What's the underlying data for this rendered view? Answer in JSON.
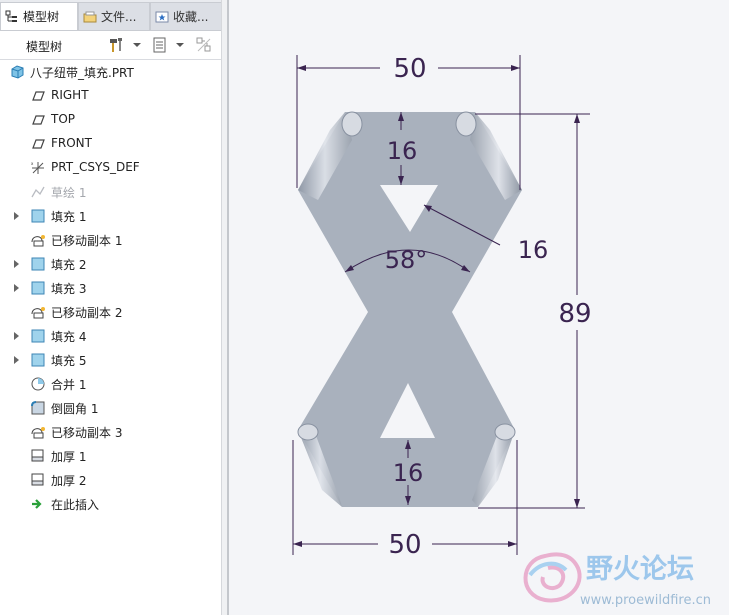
{
  "tabs": [
    {
      "label": "模型树",
      "icon": "model-tree-icon",
      "active": true
    },
    {
      "label": "文件...",
      "icon": "folder-icon",
      "active": false
    },
    {
      "label": "收藏...",
      "icon": "favorites-icon",
      "active": false
    }
  ],
  "toolbar": {
    "label": "模型树"
  },
  "tree": {
    "root": "八子纽带_填充.PRT",
    "items": [
      {
        "label": "RIGHT",
        "icon": "datum-plane-icon"
      },
      {
        "label": "TOP",
        "icon": "datum-plane-icon"
      },
      {
        "label": "FRONT",
        "icon": "datum-plane-icon"
      },
      {
        "label": "PRT_CSYS_DEF",
        "icon": "coordinate-system-icon"
      },
      {
        "label": "草绘 1",
        "icon": "sketch-icon",
        "disabled": true
      },
      {
        "label": "填充 1",
        "icon": "fill-icon",
        "expandable": true
      },
      {
        "label": "已移动副本 1",
        "icon": "moved-copy-icon"
      },
      {
        "label": "填充 2",
        "icon": "fill-icon",
        "expandable": true
      },
      {
        "label": "填充 3",
        "icon": "fill-icon",
        "expandable": true
      },
      {
        "label": "已移动副本 2",
        "icon": "moved-copy-icon"
      },
      {
        "label": "填充 4",
        "icon": "fill-icon",
        "expandable": true
      },
      {
        "label": "填充 5",
        "icon": "fill-icon",
        "expandable": true
      },
      {
        "label": "合并 1",
        "icon": "merge-icon"
      },
      {
        "label": "倒圆角 1",
        "icon": "round-icon"
      },
      {
        "label": "已移动副本 3",
        "icon": "moved-copy-icon"
      },
      {
        "label": "加厚 1",
        "icon": "thicken-icon"
      },
      {
        "label": "加厚 2",
        "icon": "thicken-icon"
      },
      {
        "label": "在此插入",
        "icon": "insert-here-icon"
      }
    ]
  },
  "dimensions": {
    "top_width": "50",
    "bottom_width": "50",
    "height": "89",
    "top_band": "16",
    "bottom_band": "16",
    "side_width": "16",
    "angle": "58°"
  },
  "watermark": {
    "title": "野火论坛",
    "url": "www.proewildfire.cn"
  },
  "colors": {
    "part": "#a9b1bd",
    "dimension": "#3a2450",
    "watermark": "#8fc0ea"
  }
}
